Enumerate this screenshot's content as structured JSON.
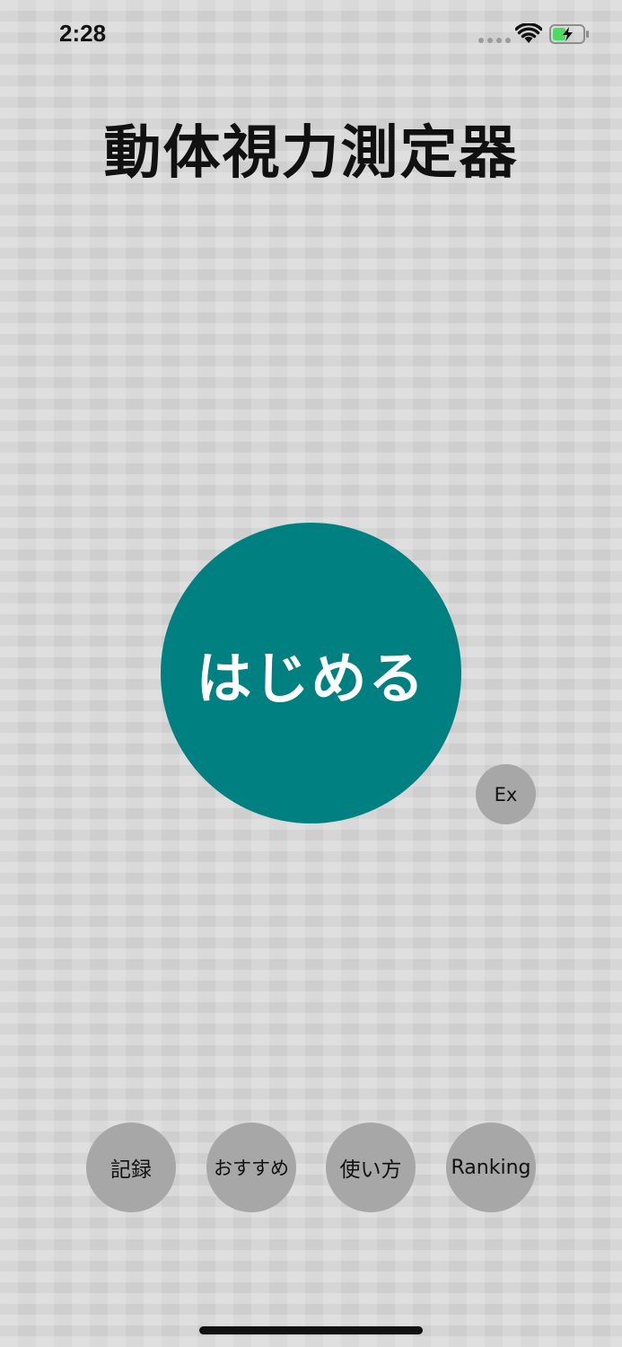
{
  "status_bar": {
    "time": "2:28",
    "icons": [
      "signal-dots-icon",
      "wifi-icon",
      "battery-charging-icon"
    ]
  },
  "title": "動体視力測定器",
  "start_button": {
    "label": "はじめる",
    "color": "#008080"
  },
  "ex_button": {
    "label": "Ex"
  },
  "bottom_buttons": {
    "record": "記録",
    "recommend": "おすすめ",
    "howto": "使い方",
    "ranking": "Ranking"
  },
  "colors": {
    "accent": "#008080",
    "secondary_button": "#a7a7a7",
    "battery_charge": "#4cd964"
  }
}
